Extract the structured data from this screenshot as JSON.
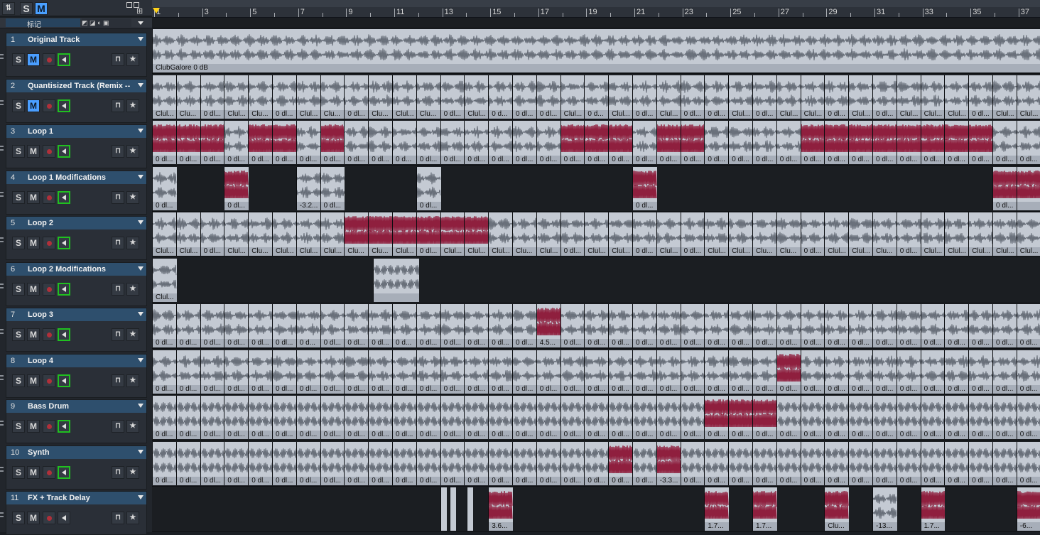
{
  "toolbar": {
    "solo_label": "S",
    "mute_label": "M"
  },
  "marker_row": {
    "label": "标记"
  },
  "ruler": {
    "bars": [
      "1",
      "3",
      "5",
      "7",
      "9",
      "11",
      "13",
      "15",
      "17",
      "19",
      "21",
      "23",
      "25",
      "27",
      "29",
      "31",
      "33",
      "35",
      "37"
    ]
  },
  "colors": {
    "clip_body": "#c4cad3",
    "clip_label": "#a7aeb9",
    "wave_normal": "#434a55",
    "wave_accent": "#8f1f3e",
    "accent_blue": "#4a9eff",
    "monitor_green": "#20c020",
    "record_red": "#b0303a"
  },
  "tracks": [
    {
      "num": "1",
      "name": "Original Track",
      "solo": "S",
      "mute": "M",
      "mute_on": true
    },
    {
      "num": "2",
      "name": "Quantisized Track (Remix --",
      "solo": "S",
      "mute": "M",
      "mute_on": true
    },
    {
      "num": "3",
      "name": "Loop 1",
      "solo": "S",
      "mute": "M",
      "mute_on": false
    },
    {
      "num": "4",
      "name": "Loop 1 Modifications",
      "solo": "S",
      "mute": "M",
      "mute_on": false
    },
    {
      "num": "5",
      "name": "Loop 2",
      "solo": "S",
      "mute": "M",
      "mute_on": false
    },
    {
      "num": "6",
      "name": "Loop 2 Modifications",
      "solo": "S",
      "mute": "M",
      "mute_on": false
    },
    {
      "num": "7",
      "name": "Loop 3",
      "solo": "S",
      "mute": "M",
      "mute_on": false
    },
    {
      "num": "8",
      "name": "Loop 4",
      "solo": "S",
      "mute": "M",
      "mute_on": false
    },
    {
      "num": "9",
      "name": "Bass Drum",
      "solo": "S",
      "mute": "M",
      "mute_on": false
    },
    {
      "num": "10",
      "name": "Synth",
      "solo": "S",
      "mute": "M",
      "mute_on": false
    },
    {
      "num": "11",
      "name": "FX + Track Delay",
      "solo": "S",
      "mute": "M",
      "mute_on": false
    }
  ],
  "lanes": {
    "track1": {
      "clip_label": "ClubGalore   0 dB"
    },
    "track2_labels": [
      "Clul...",
      "Clu...",
      "0 dl...",
      "Clul...",
      "Clu...",
      "0 dl...",
      "Clul...",
      "Clu...",
      "0 dl...",
      "Clu...",
      "Clul...",
      "Clu...",
      "0 dl...",
      "Clul...",
      "0 d...",
      "0 dl...",
      "0 dl...",
      "Clul...",
      "0 d...",
      "Clul...",
      "0 dl...",
      "Clul...",
      "0 dl...",
      "0 dl...",
      "Clul...",
      "0 dl...",
      "Clul...",
      "Clul...",
      "0 dl...",
      "Clul...",
      "0 dl...",
      "Clul...",
      "Clul...",
      "Clul...",
      "0 dl...",
      "Clul...",
      "Clul..."
    ],
    "track3_labels": [
      "0 dl...",
      "0 dl...",
      "0 dl...",
      "0 dl...",
      "0 dl...",
      "0 dl...",
      "0 dl...",
      "0 dl...",
      "0 dl...",
      "0 dl...",
      "0 d...",
      "0 dl...",
      "0 dl...",
      "0 dl...",
      "0 dl...",
      "0 dl...",
      "0 dl...",
      "0 dl...",
      "0 dl...",
      "0 dl...",
      "0 dl...",
      "0 dl...",
      "0 dl...",
      "0 dl...",
      "0 dl...",
      "0 dl...",
      "0 dl...",
      "0 dl...",
      "0 dl...",
      "0 dl...",
      "0 dl...",
      "0 dl...",
      "0 dl...",
      "0 dl...",
      "0 dl...",
      "0 dl...",
      "0 dl..."
    ],
    "track4_labels": [
      "0 dl...",
      "0 dl...",
      "-3.2...",
      "0 dl...",
      "0 dl...",
      "0 dl...",
      "0 dl..."
    ],
    "track5_labels": [
      "Clul...",
      "Clul...",
      "0 dl...",
      "Clul...",
      "Clu...",
      "Clul...",
      "Clul...",
      "Clul...",
      "Clu...",
      "Clu...",
      "Clul...",
      "0 dl...",
      "Clul...",
      "Clul...",
      "Clul...",
      "Clu...",
      "Clul...",
      "0 dl...",
      "Clul...",
      "Clul...",
      "0 dl...",
      "Clul...",
      "0 dl...",
      "Clul...",
      "Clul...",
      "Clu...",
      "Clu...",
      "0 dl...",
      "Clul...",
      "Clul...",
      "Clu...",
      "0 dl...",
      "Clul...",
      "Clul...",
      "Clul...",
      "Clul...",
      "Clul..."
    ],
    "track6_labels": [
      "Clul..."
    ],
    "track7_labels": [
      "0 dl...",
      "0 dl...",
      "0 dl...",
      "0 dl...",
      "0 dl...",
      "0 dl...",
      "0 d...",
      "0 dl...",
      "0 dl...",
      "0 dl...",
      "0 d...",
      "0 dl...",
      "0 dl...",
      "0 dl...",
      "0 dl...",
      "0 dl...",
      "4.5...",
      "0 dl...",
      "0 dl...",
      "0 dl...",
      "0 dl...",
      "0 dl...",
      "0 dl...",
      "0 dl...",
      "0 dl...",
      "0 dl...",
      "0 dl...",
      "0 dl...",
      "0 dl...",
      "0 dl...",
      "0 dl...",
      "0 dl...",
      "0 dl...",
      "0 dl...",
      "0 dl...",
      "0 dl...",
      "0 dl..."
    ],
    "track8_labels": [
      "0 dl...",
      "0 dl...",
      "0 dl...",
      "0 dl...",
      "0 dl...",
      "0 dl...",
      "0 dl...",
      "0 dl...",
      "0 dl...",
      "0 dl...",
      "0 dl...",
      "0 dl...",
      "0 dl...",
      "0 dl...",
      "0 dl...",
      "0 dl...",
      "0 dl...",
      "0 dl...",
      "0 dl...",
      "0 dl...",
      "0 dl...",
      "0 dl...",
      "0 dl...",
      "0 dl...",
      "0 dl...",
      "0 dl...",
      "0 dl...",
      "0 dl...",
      "0 dl...",
      "0 dl...",
      "0 dl...",
      "0 dl...",
      "0 dl...",
      "0 dl...",
      "0 dl...",
      "0 dl...",
      "0 dl..."
    ],
    "track9_labels": [
      "0 dl...",
      "0 dl...",
      "0 dl...",
      "0 dl...",
      "0 dl...",
      "0 dl...",
      "0 dl...",
      "0 dl...",
      "0 dl...",
      "0 dl...",
      "0 dl...",
      "0 dl...",
      "0 dl...",
      "0 dl...",
      "0 dl...",
      "0 dl...",
      "0 dl...",
      "0 dl...",
      "0 dl...",
      "0 dl...",
      "0 dl...",
      "0 dl...",
      "0 dl...",
      "0 dl...",
      "0 dl...",
      "0 dl...",
      "0 dl...",
      "0 dl...",
      "0 dl...",
      "0 dl...",
      "0 dl...",
      "0 dl...",
      "0 dl...",
      "0 dl...",
      "0 dl...",
      "0 dl...",
      "0 dl..."
    ],
    "track10_labels": [
      "0 dl...",
      "0 dl...",
      "0 dl...",
      "0 dl...",
      "0 dl...",
      "0 dl...",
      "0 dl...",
      "0 dl...",
      "0 dl...",
      "0 dl...",
      "0 dl...",
      "0 dl...",
      "0 dl...",
      "0 dl...",
      "0 dl...",
      "0 dl...",
      "0 dl...",
      "0 dl...",
      "0 dl...",
      "0 dl...",
      "0 dl...",
      "-3.3...",
      "0 dl...",
      "0 dl...",
      "0 dl...",
      "0 dl...",
      "0 dl...",
      "0 dl...",
      "0 dl...",
      "0 dl...",
      "0 dl...",
      "0 dl...",
      "0 dl...",
      "0 dl...",
      "0 dl...",
      "0 dl...",
      "0 dl..."
    ],
    "track11_labels": [
      "3.6...",
      "1.7...",
      "1.7...",
      "Clu...",
      "-13...",
      "1.7...",
      "-6..."
    ]
  }
}
